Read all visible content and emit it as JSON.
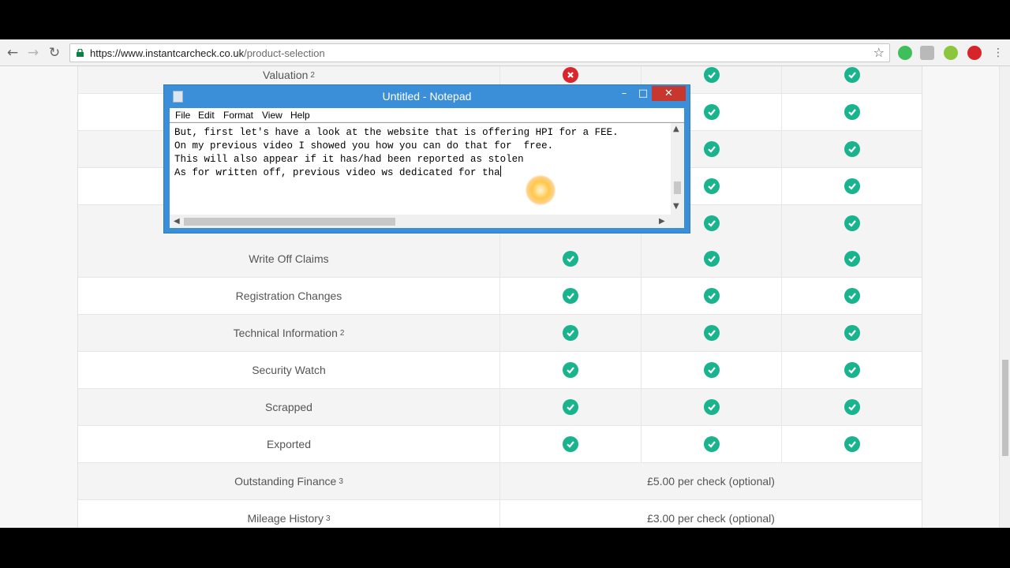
{
  "browser": {
    "url_base": "https://www.instantcarcheck.co.uk",
    "url_path": "/product-selection"
  },
  "table": {
    "top_rows": [
      {
        "label": "Valuation",
        "sup": "2",
        "marks": [
          "cross",
          "check",
          "check"
        ]
      },
      {
        "label": "",
        "sup": "",
        "marks": [
          "",
          "check",
          "check"
        ]
      },
      {
        "label": "",
        "sup": "",
        "marks": [
          "",
          "check",
          "check"
        ]
      },
      {
        "label": "",
        "sup": "",
        "marks": [
          "",
          "check",
          "check"
        ]
      },
      {
        "label": "",
        "sup": "",
        "marks": [
          "",
          "check",
          "check"
        ]
      }
    ],
    "rows": [
      {
        "label": "Write Off Claims",
        "sup": "",
        "marks": [
          "check",
          "check",
          "check"
        ]
      },
      {
        "label": "Registration Changes",
        "sup": "",
        "marks": [
          "check",
          "check",
          "check"
        ]
      },
      {
        "label": "Technical Information",
        "sup": "2",
        "marks": [
          "check",
          "check",
          "check"
        ]
      },
      {
        "label": "Security Watch",
        "sup": "",
        "marks": [
          "check",
          "check",
          "check"
        ]
      },
      {
        "label": "Scrapped",
        "sup": "",
        "marks": [
          "check",
          "check",
          "check"
        ]
      },
      {
        "label": "Exported",
        "sup": "",
        "marks": [
          "check",
          "check",
          "check"
        ]
      }
    ],
    "price_rows": [
      {
        "label": "Outstanding Finance",
        "sup": "3",
        "price": "£5.00 per check (optional)"
      },
      {
        "label": "Mileage History",
        "sup": "3",
        "price": "£3.00 per check (optional)"
      }
    ]
  },
  "notepad": {
    "title": "Untitled - Notepad",
    "menu": [
      "File",
      "Edit",
      "Format",
      "View",
      "Help"
    ],
    "lines": [
      "But, first let's have a look at the website that is offering HPI for a FEE.",
      "On my previous video I showed you how you can do that for  free.",
      "",
      "This will also appear if it has/had been reported as stolen",
      "",
      "As for written off, previous video ws dedicated for tha"
    ]
  },
  "colors": {
    "check": "#19b38e",
    "cross": "#d9262c",
    "notepad_frame": "#3b8fd9",
    "close_button": "#c7372e"
  }
}
